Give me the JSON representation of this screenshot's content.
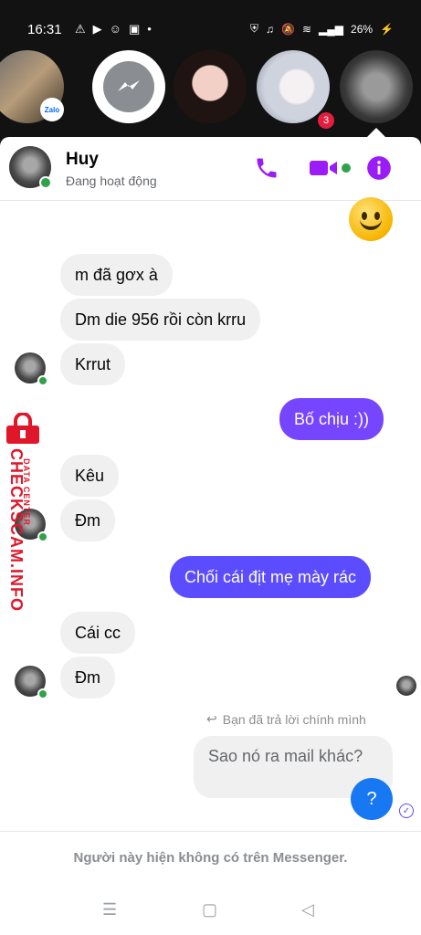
{
  "status_bar": {
    "time": "16:31",
    "left_icons": [
      "warning-icon",
      "youtube-icon",
      "messenger-cat-icon",
      "zalo-icon",
      "dot-icon"
    ],
    "right_icons": [
      "vpn-icon",
      "headset-icon",
      "mute-icon",
      "wifi-icon",
      "signal-icon"
    ],
    "battery": "26%"
  },
  "chat_heads": {
    "zalo_badge": "Zalo",
    "notification_count": "3"
  },
  "header": {
    "name": "Huy",
    "status": "Đang hoạt động"
  },
  "messages": [
    {
      "dir": "in",
      "text": "m đã gơx à"
    },
    {
      "dir": "in",
      "text": "Dm die 956 rồi còn krru"
    },
    {
      "dir": "in",
      "text": "Krrut"
    },
    {
      "dir": "out",
      "text": "Bố chịu :))"
    },
    {
      "dir": "in",
      "text": "Kêu"
    },
    {
      "dir": "in",
      "text": "Đm"
    },
    {
      "dir": "out",
      "text": "Chối cái địt mẹ mày rác"
    },
    {
      "dir": "in",
      "text": "Cái cc"
    },
    {
      "dir": "in",
      "text": "Đm"
    }
  ],
  "reply": {
    "note": "Bạn đã trả lời chính mình",
    "quoted": "Sao nó ra mail khác?"
  },
  "help_label": "?",
  "footer": "Người này hiện không có trên Messenger.",
  "watermark": {
    "main": "CHECKSCAM.INFO",
    "sub": "DATA CENTER"
  },
  "colors": {
    "accent": "#7645ff",
    "outgoing_alt": "#5b4cff",
    "icon_purple": "#9b1cf5",
    "active": "#31a24c"
  }
}
